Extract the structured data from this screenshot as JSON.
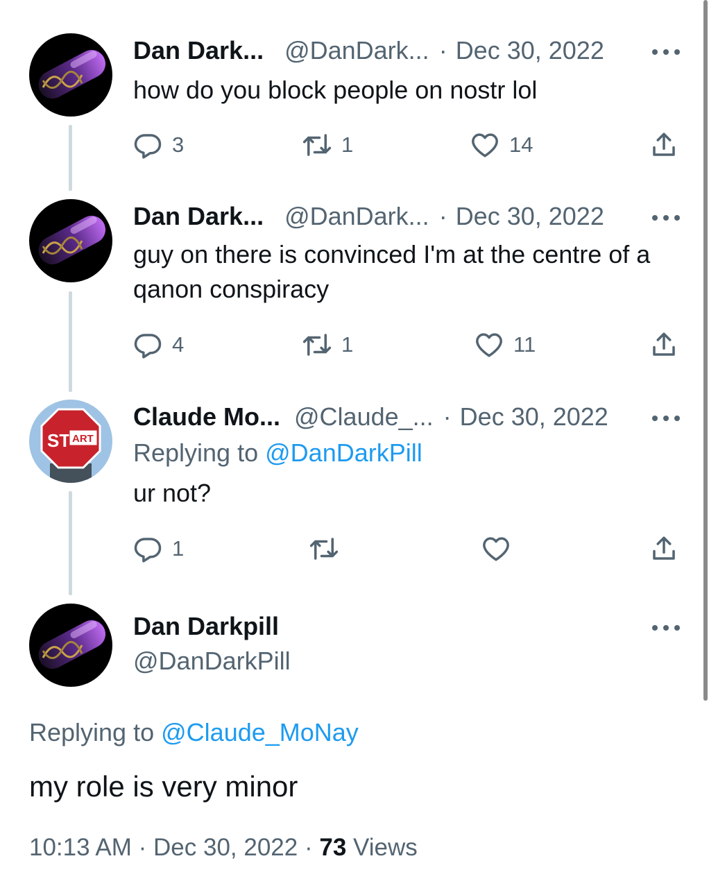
{
  "tweets": [
    {
      "name": "Dan Dark...",
      "handle": "@DanDark...",
      "separator": "·",
      "date": "Dec 30, 2022",
      "lines": [
        "how do you block people on nostr lol"
      ],
      "replies": "3",
      "retweets": "1",
      "likes": "14"
    },
    {
      "name": "Dan Dark...",
      "handle": "@DanDark...",
      "separator": "·",
      "date": "Dec 30, 2022",
      "lines": [
        "guy on there is convinced I'm at the centre of a",
        "qanon conspiracy"
      ],
      "replies": "4",
      "retweets": "1",
      "likes": "11"
    },
    {
      "name": "Claude Mo...",
      "handle": "@Claude_...",
      "separator": "·",
      "date": "Dec 30, 2022",
      "replying_prefix": "Replying to",
      "replying_handle": "@DanDarkPill",
      "lines": [
        "ur not?"
      ],
      "replies": "1",
      "retweets": "",
      "likes": ""
    }
  ],
  "main_tweet": {
    "name": "Dan Darkpill",
    "handle": "@DanDarkPill",
    "replying_prefix": "Replying to",
    "replying_handle": "@Claude_MoNay",
    "text": "my role is very minor",
    "time": "10:13 AM",
    "separator": "·",
    "date": "Dec 30, 2022",
    "separator2": "·",
    "views_count": "73",
    "views_label": "Views"
  },
  "avatars": {
    "dan": "pill-capsule-dna-avatar",
    "claude": "stop-sign-art-avatar",
    "stop_sign_text_1": "ST",
    "stop_sign_text_2": "ART"
  },
  "icons": [
    "reply-icon",
    "retweet-icon",
    "like-icon",
    "share-icon",
    "more-icon"
  ],
  "colors": {
    "text": "#0f1419",
    "secondary": "#536471",
    "link": "#1d9bf0",
    "thread_line": "#cfd9de"
  }
}
